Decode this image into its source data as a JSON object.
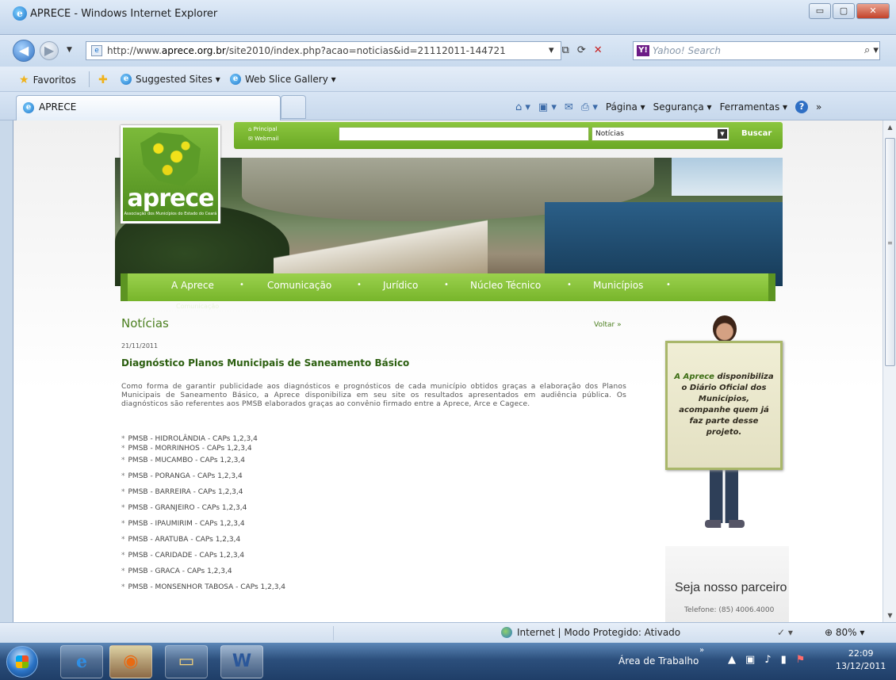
{
  "window": {
    "title": "APRECE - Windows Internet Explorer",
    "min_label": "▭",
    "max_label": "▢",
    "close_label": "✕"
  },
  "address": {
    "url_prefix": "http://www.",
    "url_domain": "aprece.org.br",
    "url_suffix": "/site2010/index.php?acao=noticias&id=21112011-144721",
    "search_placeholder": "Yahoo! Search"
  },
  "favorites": {
    "favorites_label": "Favoritos",
    "suggested_label": "Suggested Sites ▾",
    "webslice_label": "Web Slice Gallery ▾"
  },
  "tabs": {
    "active_label": "APRECE"
  },
  "command_bar": {
    "page_label": "Página ▾",
    "security_label": "Segurança ▾",
    "tools_label": "Ferramentas ▾",
    "more_label": "»"
  },
  "site": {
    "top_links": [
      "Principal",
      "Webmail"
    ],
    "search_select_value": "Notícias",
    "search_button_label": "Buscar",
    "logo_text": "aprece",
    "logo_subtext": "Associação dos Municípios do Estado do Ceará",
    "nav_items": [
      "A Aprece",
      "Comunicação",
      "Jurídico",
      "Núcleo Técnico",
      "Municípios"
    ],
    "nav_ghost_text": "Comunicação",
    "page_heading": "Notícias",
    "back_link": "Voltar »",
    "article": {
      "date": "21/11/2011",
      "title": "Diagnóstico Planos Municipais de Saneamento Básico",
      "body": "Como forma de garantir publicidade aos diagnósticos e prognósticos de cada município obtidos graças a elaboração dos Planos Municipais de Saneamento Básico, a Aprece disponibiliza em seu site os resultados apresentados em audiência pública. Os diagnósticos são referentes aos PMSB elaborados graças ao convênio firmado entre a Aprece, Arce e Cagece."
    },
    "pmsb_links": [
      "PMSB - HIDROLÂNDIA - CAPs 1,2,3,4",
      "PMSB - MORRINHOS - CAPs 1,2,3,4",
      "PMSB - MUCAMBO - CAPs 1,2,3,4",
      "PMSB - PORANGA - CAPs 1,2,3,4",
      "PMSB - BARREIRA - CAPs 1,2,3,4",
      "PMSB - GRANJEIRO - CAPs 1,2,3,4",
      "PMSB - IPAUMIRIM - CAPs 1,2,3,4",
      "PMSB - ARATUBA - CAPs 1,2,3,4",
      "PMSB - CARIDADE - CAPs 1,2,3,4",
      "PMSB - GRACA - CAPs 1,2,3,4",
      "PMSB - MONSENHOR TABOSA - CAPs 1,2,3,4"
    ],
    "promo": {
      "highlight": "A Aprece",
      "text": " disponibiliza o Diário Oficial dos Municípios, acompanhe quem já faz parte desse projeto."
    },
    "partner": {
      "title": "Seja nosso parceiro",
      "phone": "Telefone: (85) 4006.4000"
    }
  },
  "status": {
    "zone_text": "Internet | Modo Protegido: Ativado",
    "zoom": "80%"
  },
  "taskbar": {
    "desktop_label": "Área de Trabalho",
    "time": "22:09",
    "date": "13/12/2011"
  },
  "colors": {
    "site_green": "#6aa824",
    "heading_green": "#4b7f1f",
    "ie_blue": "#1a73c9"
  }
}
